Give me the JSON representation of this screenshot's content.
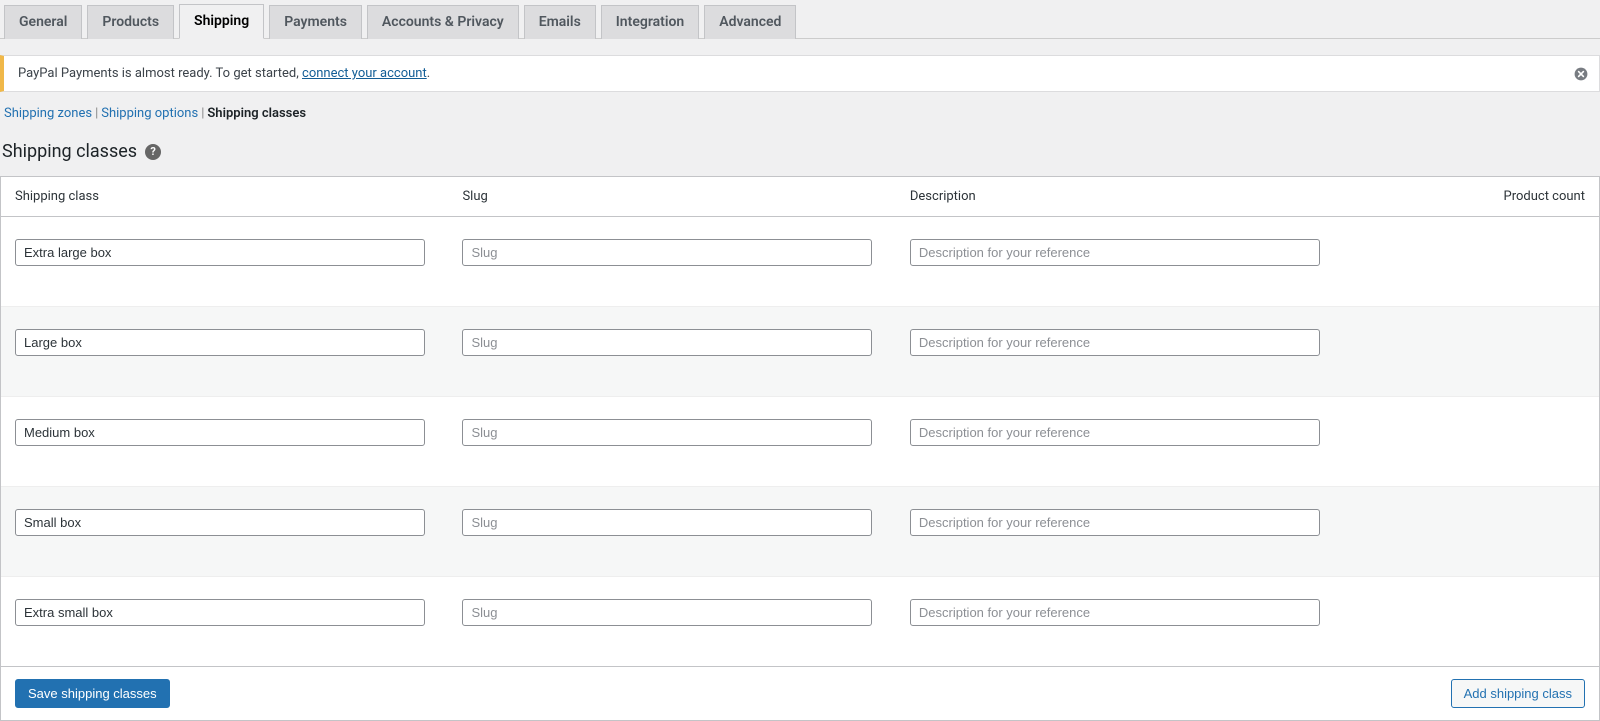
{
  "tabs": [
    {
      "label": "General",
      "active": false
    },
    {
      "label": "Products",
      "active": false
    },
    {
      "label": "Shipping",
      "active": true
    },
    {
      "label": "Payments",
      "active": false
    },
    {
      "label": "Accounts & Privacy",
      "active": false
    },
    {
      "label": "Emails",
      "active": false
    },
    {
      "label": "Integration",
      "active": false
    },
    {
      "label": "Advanced",
      "active": false
    }
  ],
  "notice": {
    "text_before_link": "PayPal Payments is almost ready. To get started, ",
    "link_text": "connect your account",
    "text_after_link": "."
  },
  "subnav": {
    "items": [
      {
        "label": "Shipping zones",
        "current": false
      },
      {
        "label": "Shipping options",
        "current": false
      },
      {
        "label": "Shipping classes",
        "current": true
      }
    ],
    "separator": "|"
  },
  "heading": "Shipping classes",
  "help_tip_glyph": "?",
  "table": {
    "headers": {
      "class": "Shipping class",
      "slug": "Slug",
      "description": "Description",
      "count": "Product count"
    },
    "placeholders": {
      "slug": "Slug",
      "description": "Description for your reference"
    },
    "rows": [
      {
        "name": "Extra large box",
        "slug": "",
        "description": "",
        "count": ""
      },
      {
        "name": "Large box",
        "slug": "",
        "description": "",
        "count": ""
      },
      {
        "name": "Medium box",
        "slug": "",
        "description": "",
        "count": ""
      },
      {
        "name": "Small box",
        "slug": "",
        "description": "",
        "count": ""
      },
      {
        "name": "Extra small box",
        "slug": "",
        "description": "",
        "count": ""
      }
    ],
    "footer": {
      "save_label": "Save shipping classes",
      "add_label": "Add shipping class"
    }
  }
}
